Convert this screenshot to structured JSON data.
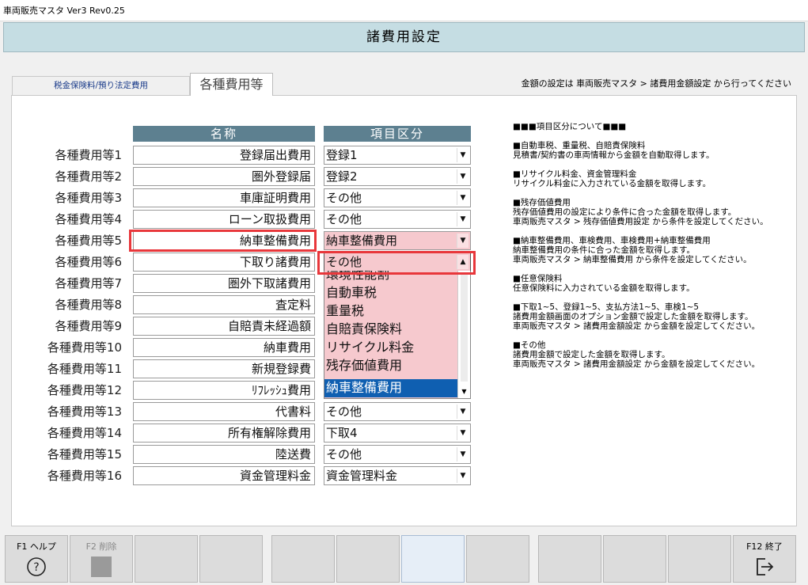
{
  "window": {
    "title": "車両販売マスタ Ver3 Rev0.25"
  },
  "header": {
    "title": "諸費用設定"
  },
  "tabs": [
    {
      "label": "税金保険料/預り法定費用"
    },
    {
      "label": "各種費用等"
    }
  ],
  "tab_note": "金額の設定は 車両販売マスタ > 諸費用金額設定 から行ってください",
  "columns": {
    "name": "名称",
    "category": "項目区分"
  },
  "rows": [
    {
      "label": "各種費用等1",
      "name": "登録届出費用",
      "category": "登録1"
    },
    {
      "label": "各種費用等2",
      "name": "圏外登録届",
      "category": "登録2"
    },
    {
      "label": "各種費用等3",
      "name": "車庫証明費用",
      "category": "その他"
    },
    {
      "label": "各種費用等4",
      "name": "ローン取扱費用",
      "category": "その他"
    },
    {
      "label": "各種費用等5",
      "name": "納車整備費用",
      "category": "納車整備費用"
    },
    {
      "label": "各種費用等6",
      "name": "下取り諸費用",
      "category": "その他"
    },
    {
      "label": "各種費用等7",
      "name": "圏外下取諸費用",
      "category": ""
    },
    {
      "label": "各種費用等8",
      "name": "査定料",
      "category": ""
    },
    {
      "label": "各種費用等9",
      "name": "自賠責未経過額",
      "category": ""
    },
    {
      "label": "各種費用等10",
      "name": "納車費用",
      "category": ""
    },
    {
      "label": "各種費用等11",
      "name": "新規登録費",
      "category": ""
    },
    {
      "label": "各種費用等12",
      "name": "ﾘﾌﾚｯｼｭ費用",
      "category": ""
    },
    {
      "label": "各種費用等13",
      "name": "代書料",
      "category": "その他"
    },
    {
      "label": "各種費用等14",
      "name": "所有権解除費用",
      "category": "下取4"
    },
    {
      "label": "各種費用等15",
      "name": "陸送費",
      "category": "その他"
    },
    {
      "label": "各種費用等16",
      "name": "資金管理料金",
      "category": "資金管理料金"
    }
  ],
  "dropdown": {
    "options": [
      "環境性能割",
      "自動車税",
      "重量税",
      "自賠責保険料",
      "リサイクル料金",
      "残存価値費用",
      "納車整備費用"
    ],
    "selected": "納車整備費用"
  },
  "info": {
    "title": "■■■項目区分について■■■",
    "sections": [
      {
        "heading": "■自動車税、重量税、自賠責保険料",
        "text": "見積書/契約書の車両情報から金額を自動取得します。"
      },
      {
        "heading": "■リサイクル料金、資金管理料金",
        "text": "リサイクル料金に入力されている金額を取得します。"
      },
      {
        "heading": "■残存価値費用",
        "text": "残存価値費用の設定により条件に合った金額を取得します。\n車両販売マスタ > 残存価値費用設定 から条件を設定してください。"
      },
      {
        "heading": "■納車整備費用、車検費用、車検費用+納車整備費用",
        "text": "納車整備費用の条件に合った金額を取得します。\n車両販売マスタ > 納車整備費用 から条件を設定してください。"
      },
      {
        "heading": "■任意保険料",
        "text": "任意保険料に入力されている金額を取得します。"
      },
      {
        "heading": "■下取1~5、登録1~5、支払方法1~5、車検1~5",
        "text": "諸費用金額画面のオプション金額で設定した金額を取得します。\n車両販売マスタ > 諸費用金額設定 から金額を設定してください。"
      },
      {
        "heading": "■その他",
        "text": "諸費用金額で設定した金額を取得します。\n車両販売マスタ > 諸費用金額設定 から金額を設定してください。"
      }
    ]
  },
  "fkeys": {
    "f1": "F1 ヘルプ",
    "f2": "F2 削除",
    "f12": "F12 終了"
  },
  "colors": {
    "header_bg": "#c5dde3",
    "column_head_bg": "#5d8090",
    "pink": "#f6c9ce",
    "highlight": "#e8373b",
    "selected": "#0f5fb1"
  }
}
